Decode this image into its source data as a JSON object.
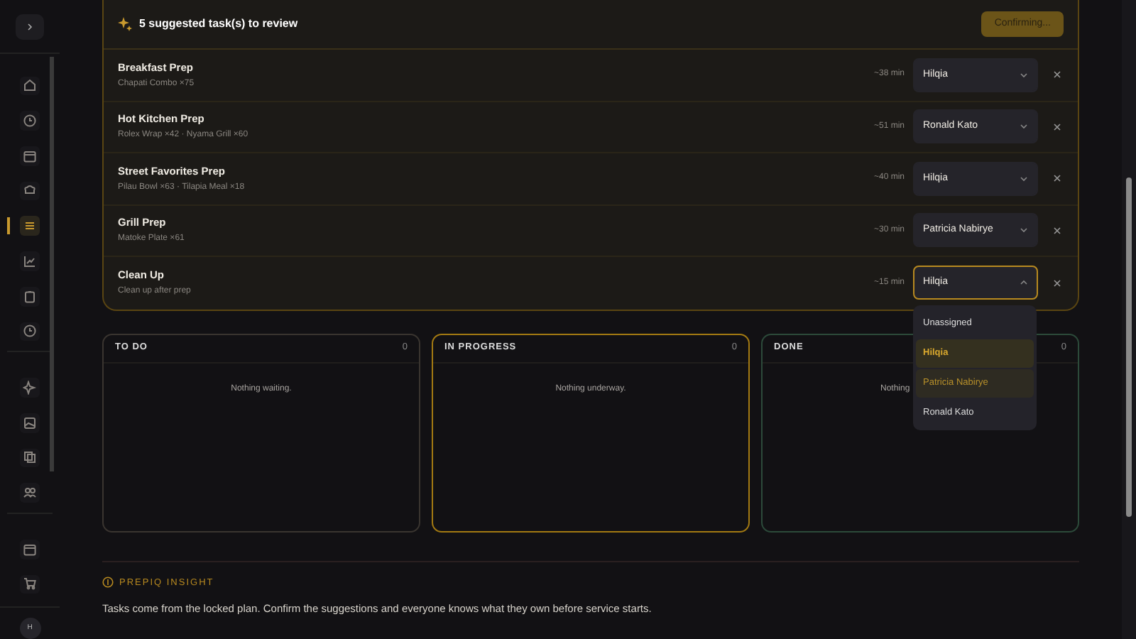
{
  "review": {
    "heading": "5 suggested task(s) to review",
    "confirm_button": {
      "label": "Confirming...",
      "disabled": true
    },
    "tasks": [
      {
        "title": "Breakfast Prep",
        "details": "Chapati Combo ×75",
        "estimate": "~38 min",
        "assignee": "Hilqia",
        "open": false
      },
      {
        "title": "Hot Kitchen Prep",
        "details": "Rolex Wrap ×42 · Nyama Grill ×60",
        "estimate": "~51 min",
        "assignee": "Ronald Kato",
        "open": false
      },
      {
        "title": "Street Favorites Prep",
        "details": "Pilau Bowl ×63 · Tilapia Meal ×18",
        "estimate": "~40 min",
        "assignee": "Hilqia",
        "open": false
      },
      {
        "title": "Grill Prep",
        "details": "Matoke Plate ×61",
        "estimate": "~30 min",
        "assignee": "Patricia Nabirye",
        "open": false
      },
      {
        "title": "Clean Up",
        "details": "Clean up after prep",
        "estimate": "~15 min",
        "assignee": "Hilqia",
        "open": true
      }
    ]
  },
  "assignee_menu": [
    {
      "label": "Unassigned",
      "selected": false,
      "hovered": false
    },
    {
      "label": "Hilqia",
      "selected": true,
      "hovered": false
    },
    {
      "label": "Patricia Nabirye",
      "selected": false,
      "hovered": true
    },
    {
      "label": "Ronald Kato",
      "selected": false,
      "hovered": false
    }
  ],
  "board": [
    {
      "title": "TO DO",
      "count": "0",
      "empty_text": "Nothing waiting.",
      "color": "#3a3530"
    },
    {
      "title": "IN PROGRESS",
      "count": "0",
      "empty_text": "Nothing underway.",
      "color": "#a37a12"
    },
    {
      "title": "DONE",
      "count": "0",
      "empty_text": "Nothing",
      "color": "#2c4a3a"
    }
  ],
  "insight": {
    "title": "PREPIQ INSIGHT",
    "text": "Tasks come from the locked plan. Confirm the suggestions and everyone knows what they own before service starts."
  },
  "sidebar": {
    "items": [
      {
        "selected": false
      },
      {
        "selected": false
      },
      {
        "selected": false
      },
      {
        "selected": false
      },
      {
        "selected": true
      },
      {
        "selected": false
      },
      {
        "selected": false
      },
      {
        "selected": false
      },
      {
        "selected": false
      },
      {
        "selected": false
      },
      {
        "selected": false
      },
      {
        "selected": false
      },
      {
        "selected": false
      },
      {
        "selected": false
      }
    ],
    "avatar": "H"
  }
}
